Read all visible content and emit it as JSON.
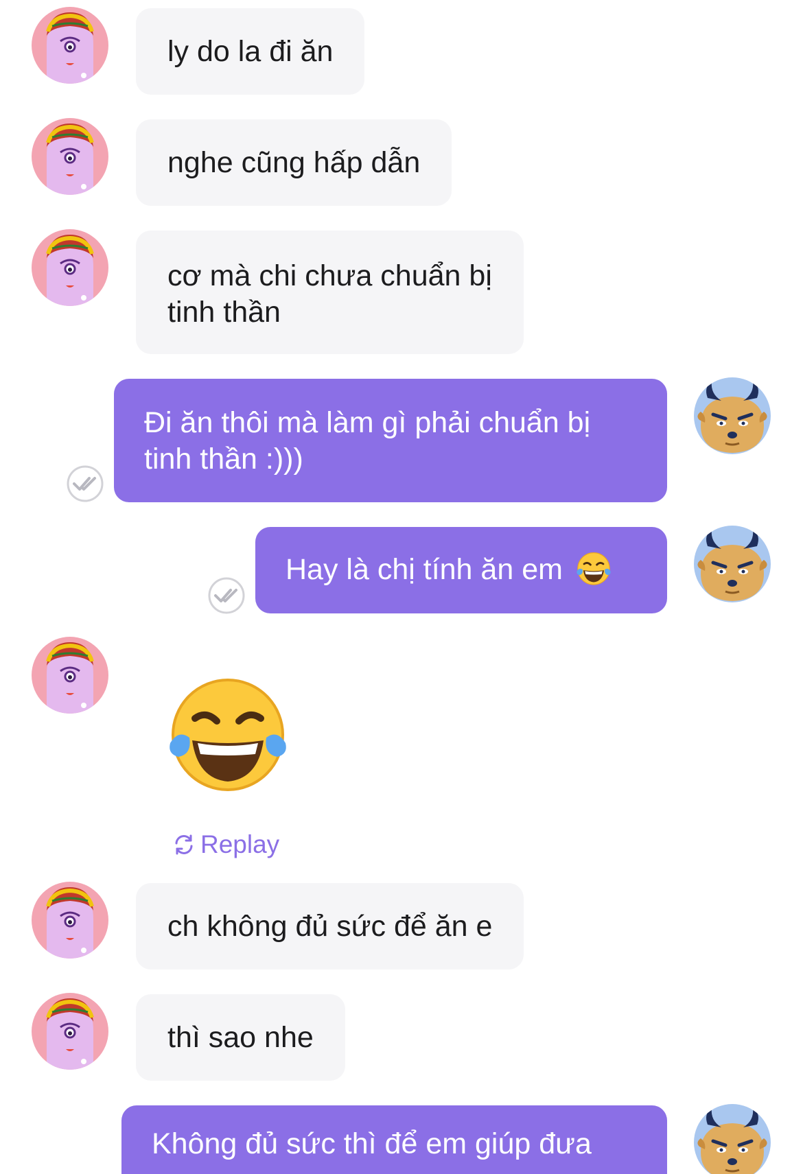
{
  "messages": [
    {
      "side": "in",
      "text": "ly do la đi ăn"
    },
    {
      "side": "in",
      "text": "nghe cũng hấp dẫn"
    },
    {
      "side": "in",
      "line1": "cơ mà chi chưa chuẩn bị",
      "line2": "tinh thần"
    },
    {
      "side": "out",
      "line1": "Đi ăn thôi mà làm gì phải chuẩn bị",
      "line2": "tinh thần :)))"
    },
    {
      "side": "out",
      "text": "Hay là chị tính ăn em",
      "emoji": "face-with-tears-of-joy"
    },
    {
      "side": "in",
      "sticker": "face-with-tears-of-joy",
      "replay_label": "Replay"
    },
    {
      "side": "in",
      "text": "ch không đủ sức để ăn e"
    },
    {
      "side": "in",
      "text": "thì sao nhe"
    },
    {
      "side": "out",
      "line1": "Không đủ sức thì để em giúp đưa"
    }
  ],
  "avatars": {
    "contact": "pink-cyclops-avatar-icon",
    "self": "horned-bull-avatar-icon"
  },
  "status_icons": [
    "seen-check-icon"
  ],
  "colors": {
    "outgoing_bubble": "#8b6fe6",
    "incoming_bubble": "#f5f5f7",
    "incoming_text": "#1c1c1e",
    "accent": "#8b6fe6"
  }
}
